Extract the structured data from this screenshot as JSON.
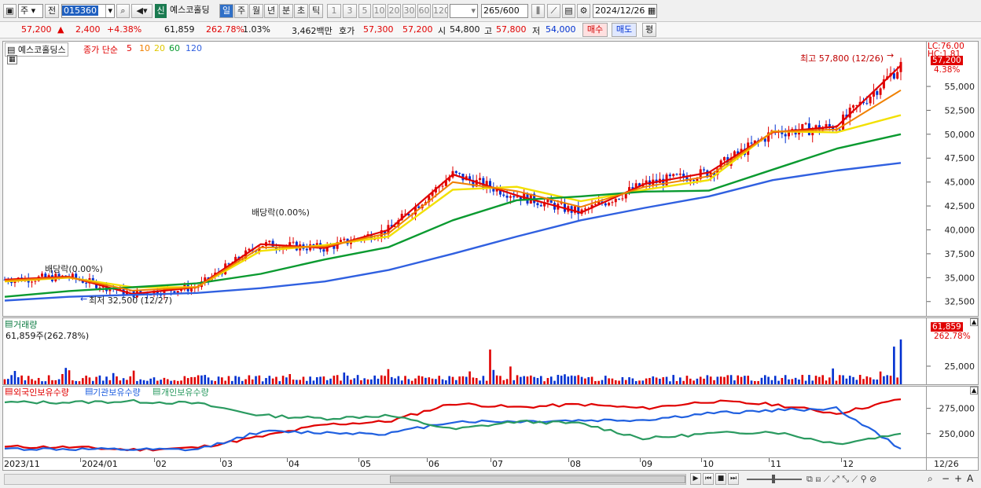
{
  "toolbar": {
    "period_mode": "주",
    "prev_label": "전",
    "code": "015360",
    "new_badge": "신",
    "name": "예스코홀딩",
    "periods": [
      "일",
      "주",
      "월",
      "년",
      "분",
      "초",
      "틱"
    ],
    "active_period": "일",
    "numbers": [
      "1",
      "3",
      "5",
      "10",
      "20",
      "30",
      "60",
      "120"
    ],
    "count": "265",
    "count_total": "/600",
    "date": "2024/12/26"
  },
  "quote": {
    "price": "57,200",
    "change": "2,400",
    "change_pct": "+4.38%",
    "volume": "61,859",
    "volume_ratio": "262.78%",
    "turnover": "1.03%",
    "amount": "3,462백만",
    "bid_label": "호가",
    "ask": "57,300",
    "bid": "57,200",
    "open_label": "시",
    "open": "54,800",
    "high_label": "고",
    "high": "57,800",
    "low_label": "저",
    "low": "54,000",
    "buy_label": "매수",
    "sell_label": "매도",
    "avg_label": "평"
  },
  "colors": {
    "up": "#e00000",
    "down": "#0030d0",
    "ma5": "#e00000",
    "ma10": "#f08000",
    "ma20": "#f2e000",
    "ma60": "#0a9a30",
    "ma120": "#3060e0",
    "foreign": "#e00000",
    "inst": "#2060e0",
    "indiv": "#2a9a60"
  },
  "price_panel": {
    "legend_name": "예스코홀딩스",
    "legend_type": "종가 단순",
    "ma_periods": [
      "5",
      "10",
      "20",
      "60",
      "120"
    ],
    "lc_label": "LC:76.00",
    "hc_label": "HC:1.81",
    "price_tag": "57,200",
    "pct_tag": "4.38%",
    "high_note": "최고 57,800 (12/26)",
    "low_note": "최저 32,500 (12/27)",
    "div1": "배당락(0.00%)",
    "div2": "배당락(0.00%)"
  },
  "volume_panel": {
    "title": "거래량",
    "value_note": "61,859주(262.78%)",
    "tag": "61,859",
    "tag_pct": "262.78%"
  },
  "holdings_panel": {
    "foreign": "외국인보유수량",
    "inst": "기관보유수량",
    "indiv": "개인보유수량"
  },
  "x_axis": {
    "labels": [
      "2023/11",
      "2024/01",
      "02",
      "03",
      "04",
      "05",
      "06",
      "07",
      "08",
      "09",
      "10",
      "11",
      "12"
    ],
    "end_label": "12/26"
  },
  "chart_data": [
    {
      "type": "line",
      "title": "",
      "series_note": "price moving averages (approximate, sampled)",
      "x": [
        "2023/11",
        "2023/12",
        "2024/01",
        "2024/02",
        "2024/03",
        "2024/04",
        "2024/05",
        "2024/06",
        "2024/07",
        "2024/08",
        "2024/09",
        "2024/10",
        "2024/11",
        "2024/12",
        "12/26"
      ],
      "series": [
        {
          "name": "5",
          "values": [
            34800,
            35100,
            33300,
            34000,
            38500,
            38100,
            40000,
            45800,
            43600,
            41800,
            44800,
            46000,
            50200,
            50800,
            57200
          ]
        },
        {
          "name": "20",
          "values": [
            34600,
            35000,
            34000,
            34000,
            37800,
            38400,
            39300,
            44200,
            44500,
            43000,
            44200,
            45200,
            50300,
            50200,
            52000
          ]
        },
        {
          "name": "60",
          "values": [
            33000,
            33600,
            34000,
            34400,
            35400,
            36900,
            38200,
            41000,
            43100,
            43500,
            44000,
            44100,
            46300,
            48500,
            50000
          ]
        },
        {
          "name": "120",
          "values": [
            32600,
            33000,
            33200,
            33400,
            33900,
            34600,
            35800,
            37500,
            39300,
            41000,
            42300,
            43500,
            45200,
            46200,
            47000
          ]
        }
      ],
      "yticks": [
        32500,
        35000,
        37500,
        40000,
        42500,
        45000,
        47500,
        50000,
        52500,
        55000
      ],
      "ylim": [
        31000,
        59600
      ]
    },
    {
      "type": "bar",
      "title": "거래량",
      "yticks": [
        25000
      ],
      "last_value": 61859,
      "ylim": [
        0,
        64000
      ]
    },
    {
      "type": "line",
      "title": "",
      "series_note": "holdings (approximate, sampled)",
      "x": [
        "2023/11",
        "2023/12",
        "2024/01",
        "2024/02",
        "2024/03",
        "2024/04",
        "2024/05",
        "2024/06",
        "2024/07",
        "2024/08",
        "2024/09",
        "2024/10",
        "2024/11",
        "2024/12",
        "12/26"
      ],
      "series": [
        {
          "name": "외국인보유수량",
          "values": [
            237000,
            236500,
            234000,
            236000,
            247000,
            259000,
            262000,
            280000,
            276000,
            279000,
            275000,
            282000,
            279000,
            270000,
            284000
          ]
        },
        {
          "name": "기관보유수량",
          "values": [
            235000,
            234500,
            234000,
            234000,
            252000,
            251000,
            250000,
            262000,
            262000,
            263000,
            263500,
            270000,
            273000,
            275000,
            235000
          ]
        },
        {
          "name": "개인보유수량",
          "values": [
            281000,
            281000,
            282000,
            280000,
            268000,
            265000,
            268000,
            254000,
            262000,
            260000,
            245000,
            250000,
            252000,
            240000,
            250000
          ]
        }
      ],
      "yticks": [
        250000,
        275000
      ],
      "ylim": [
        228000,
        288000
      ]
    }
  ]
}
